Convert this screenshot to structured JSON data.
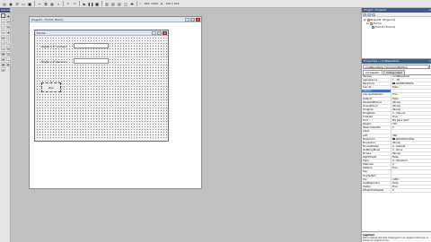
{
  "toolbar": {
    "coord_pos": "360, 3360",
    "coord_size": "720 x 476"
  },
  "toolbox": {
    "title": "General",
    "tools": [
      "pointer-icon",
      "picture-icon",
      "label-icon",
      "textbox-icon",
      "frame-icon",
      "commandbutton-icon",
      "checkbox-icon",
      "optionbutton-icon",
      "combobox-icon",
      "listbox-icon",
      "hscroll-icon",
      "vscroll-icon",
      "timer-icon",
      "drive-icon",
      "folder-icon",
      "file-icon",
      "shape-icon",
      "line-icon",
      "image-icon",
      "data-icon",
      "ole-icon"
    ]
  },
  "project_window": {
    "title": "Project1 - Form1 (Form)"
  },
  "form": {
    "title": "Form1",
    "label1": "Digite o 1º número",
    "label2": "Digite o 2º Número",
    "button": "Run"
  },
  "project_pane": {
    "title": "Project - Project1",
    "tree": [
      "Project1 (Project1)",
      "Forms",
      "Form1 (Form1)"
    ]
  },
  "properties_pane": {
    "title": "Properties - cmdResultado",
    "object": "cmdResultado  CommandButton",
    "tabs": [
      "Alphabetic",
      "Categorized"
    ],
    "rows": [
      {
        "name": "(Name)",
        "value": "cmdResultado"
      },
      {
        "name": "Appearance",
        "value": "1 - 3D"
      },
      {
        "name": "BackColor",
        "value": "&H8000000F&"
      },
      {
        "name": "Cancel",
        "value": "False"
      },
      {
        "name": "Caption",
        "value": ""
      },
      {
        "name": "CausesValidation",
        "value": "True"
      },
      {
        "name": "Default",
        "value": "False"
      },
      {
        "name": "DisabledPicture",
        "value": "(None)"
      },
      {
        "name": "DownPicture",
        "value": "(None)"
      },
      {
        "name": "DragIcon",
        "value": "(None)"
      },
      {
        "name": "DragMode",
        "value": "0 - Manual"
      },
      {
        "name": "Enabled",
        "value": "True"
      },
      {
        "name": "Font",
        "value": "MS Sans Serif"
      },
      {
        "name": "Height",
        "value": "375"
      },
      {
        "name": "HelpContextID",
        "value": "0"
      },
      {
        "name": "Index",
        "value": ""
      },
      {
        "name": "Left",
        "value": "360"
      },
      {
        "name": "MaskColor",
        "value": "&H00C0C0C0&"
      },
      {
        "name": "MouseIcon",
        "value": "(None)"
      },
      {
        "name": "MousePointer",
        "value": "0 - Default"
      },
      {
        "name": "OLEDropMode",
        "value": "0 - None"
      },
      {
        "name": "Picture",
        "value": "(None)"
      },
      {
        "name": "RightToLeft",
        "value": "False"
      },
      {
        "name": "Style",
        "value": "0 - Standard"
      },
      {
        "name": "TabIndex",
        "value": "4"
      },
      {
        "name": "TabStop",
        "value": "True"
      },
      {
        "name": "Tag",
        "value": ""
      },
      {
        "name": "ToolTipText",
        "value": ""
      },
      {
        "name": "Top",
        "value": "1080"
      },
      {
        "name": "UseMaskColor",
        "value": "False"
      },
      {
        "name": "Visible",
        "value": "True"
      },
      {
        "name": "WhatsThisHelpID",
        "value": "0"
      }
    ],
    "desc_title": "Caption",
    "desc_text": "Returns/sets the text displayed in an object's title bar or below an object's icon."
  },
  "colors": {
    "pane_title": "#3c5a8a",
    "selected": "#3c6fc0",
    "close": "#c9473a"
  }
}
